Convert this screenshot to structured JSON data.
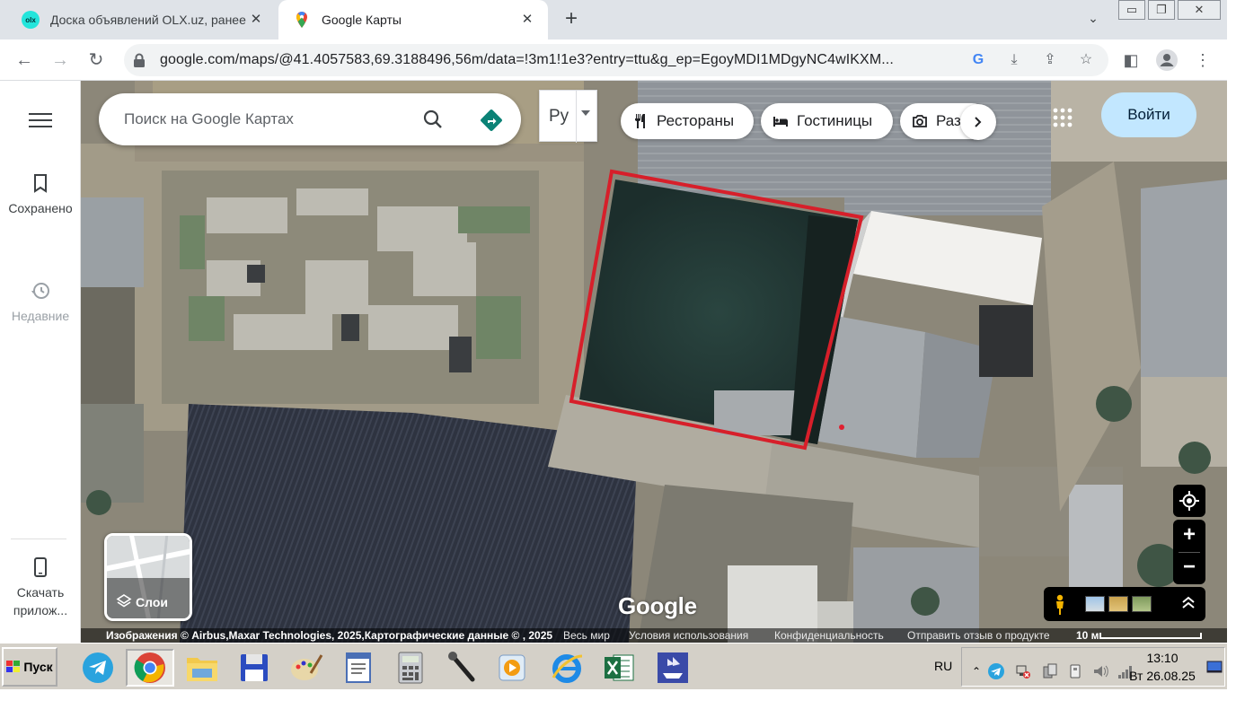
{
  "browser": {
    "tabs": [
      {
        "title": "Доска объявлений OLX.uz, ранее Т",
        "favicon": "olx-favicon",
        "favicon_text": "olx",
        "active": false
      },
      {
        "title": "Google Карты",
        "favicon": "google-maps-pin-icon",
        "active": true
      }
    ],
    "url": "google.com/maps/@41.4057583,69.3188496,56m/data=!3m1!1e3?entry=ttu&g_ep=EgoyMDI1MDgyNC4wIKXM..."
  },
  "maps": {
    "search": {
      "placeholder": "Поиск на Google Картах"
    },
    "ime_label": "Ру",
    "chips": [
      {
        "label": "Рестораны",
        "icon": "fork-knife-icon"
      },
      {
        "label": "Гостиницы",
        "icon": "bed-icon"
      },
      {
        "label": "Разв",
        "icon": "camera-icon"
      }
    ],
    "signin_label": "Войти",
    "rail": {
      "saved_label": "Сохранено",
      "recent_label": "Недавние",
      "download_label": "Скачать прилож..."
    },
    "layers_label": "Слои",
    "logo": "Google",
    "footer": {
      "attribution": "Изображения © Airbus,Maxar Technologies, 2025,Картографические данные © , 2025",
      "world": "Весь мир",
      "terms": "Условия использования",
      "privacy": "Конфиденциальность",
      "feedback": "Отправить отзыв о продукте",
      "scale": "10 м"
    },
    "accent_color": "#c2e7ff",
    "outline_color": "#d71f2a"
  },
  "taskbar": {
    "start_label": "Пуск",
    "language": "RU",
    "time": "13:10",
    "date": "Вт 26.08.25"
  }
}
